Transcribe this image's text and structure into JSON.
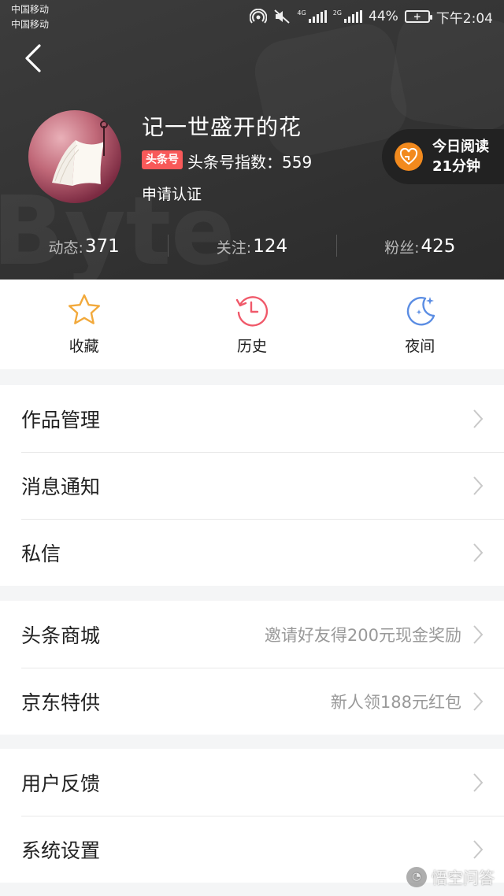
{
  "status_bar": {
    "carrier_1": "中国移动",
    "carrier_2": "中国移动",
    "network_1": "4G",
    "network_2": "2G",
    "battery_pct": "44%",
    "time": "下午2:04"
  },
  "profile": {
    "name": "记一世盛开的花",
    "badge": "头条号",
    "index_text": "头条号指数：559",
    "verify_text": "申请认证",
    "reading": {
      "line1": "今日阅读",
      "line2": "21分钟"
    }
  },
  "stats": [
    {
      "label": "动态:",
      "value": "371"
    },
    {
      "label": "关注:",
      "value": "124"
    },
    {
      "label": "粉丝:",
      "value": "425"
    }
  ],
  "quick_actions": [
    {
      "label": "收藏",
      "icon": "star-icon",
      "color": "#f2a93b"
    },
    {
      "label": "历史",
      "icon": "history-clock-icon",
      "color": "#f0596a"
    },
    {
      "label": "夜间",
      "icon": "moon-icon",
      "color": "#5b8de3"
    }
  ],
  "menu": {
    "group1": [
      {
        "title": "作品管理",
        "sub": ""
      },
      {
        "title": "消息通知",
        "sub": ""
      },
      {
        "title": "私信",
        "sub": ""
      }
    ],
    "group2": [
      {
        "title": "头条商城",
        "sub": "邀请好友得200元现金奖励"
      },
      {
        "title": "京东特供",
        "sub": "新人领188元红包"
      }
    ],
    "group3": [
      {
        "title": "用户反馈",
        "sub": ""
      },
      {
        "title": "系统设置",
        "sub": ""
      }
    ]
  },
  "watermark": "悟空问答",
  "colors": {
    "header_bg": "#333333",
    "badge_red": "#f85959",
    "reading_orange": "#f28a1e"
  }
}
